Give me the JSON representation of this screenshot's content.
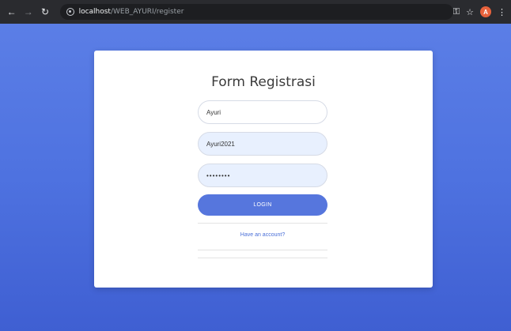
{
  "browser": {
    "url_host": "localhost",
    "url_path": "/WEB_AYURI/register",
    "profile_initial": "A"
  },
  "form": {
    "title": "Form Registrasi",
    "name_value": "Ayuri",
    "username_value": "Ayuri2021",
    "password_value": "••••••••",
    "submit_label": "LOGIN",
    "account_link": "Have an account?"
  },
  "colors": {
    "background_gradient_top": "#5b7ee6",
    "background_gradient_bottom": "#3f5fd2",
    "button": "#5676dd",
    "autofill_field": "#e8f0fe"
  }
}
